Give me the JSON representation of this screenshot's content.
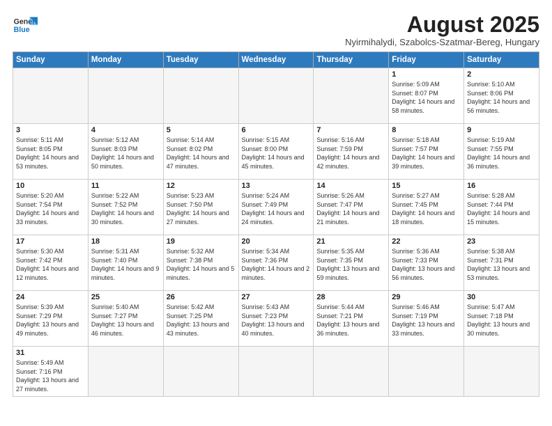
{
  "logo": {
    "line1": "General",
    "line2": "Blue"
  },
  "title": "August 2025",
  "location": "Nyirmihalydi, Szabolcs-Szatmar-Bereg, Hungary",
  "days_of_week": [
    "Sunday",
    "Monday",
    "Tuesday",
    "Wednesday",
    "Thursday",
    "Friday",
    "Saturday"
  ],
  "weeks": [
    [
      {
        "day": "",
        "info": ""
      },
      {
        "day": "",
        "info": ""
      },
      {
        "day": "",
        "info": ""
      },
      {
        "day": "",
        "info": ""
      },
      {
        "day": "",
        "info": ""
      },
      {
        "day": "1",
        "info": "Sunrise: 5:09 AM\nSunset: 8:07 PM\nDaylight: 14 hours and 58 minutes."
      },
      {
        "day": "2",
        "info": "Sunrise: 5:10 AM\nSunset: 8:06 PM\nDaylight: 14 hours and 56 minutes."
      }
    ],
    [
      {
        "day": "3",
        "info": "Sunrise: 5:11 AM\nSunset: 8:05 PM\nDaylight: 14 hours and 53 minutes."
      },
      {
        "day": "4",
        "info": "Sunrise: 5:12 AM\nSunset: 8:03 PM\nDaylight: 14 hours and 50 minutes."
      },
      {
        "day": "5",
        "info": "Sunrise: 5:14 AM\nSunset: 8:02 PM\nDaylight: 14 hours and 47 minutes."
      },
      {
        "day": "6",
        "info": "Sunrise: 5:15 AM\nSunset: 8:00 PM\nDaylight: 14 hours and 45 minutes."
      },
      {
        "day": "7",
        "info": "Sunrise: 5:16 AM\nSunset: 7:59 PM\nDaylight: 14 hours and 42 minutes."
      },
      {
        "day": "8",
        "info": "Sunrise: 5:18 AM\nSunset: 7:57 PM\nDaylight: 14 hours and 39 minutes."
      },
      {
        "day": "9",
        "info": "Sunrise: 5:19 AM\nSunset: 7:55 PM\nDaylight: 14 hours and 36 minutes."
      }
    ],
    [
      {
        "day": "10",
        "info": "Sunrise: 5:20 AM\nSunset: 7:54 PM\nDaylight: 14 hours and 33 minutes."
      },
      {
        "day": "11",
        "info": "Sunrise: 5:22 AM\nSunset: 7:52 PM\nDaylight: 14 hours and 30 minutes."
      },
      {
        "day": "12",
        "info": "Sunrise: 5:23 AM\nSunset: 7:50 PM\nDaylight: 14 hours and 27 minutes."
      },
      {
        "day": "13",
        "info": "Sunrise: 5:24 AM\nSunset: 7:49 PM\nDaylight: 14 hours and 24 minutes."
      },
      {
        "day": "14",
        "info": "Sunrise: 5:26 AM\nSunset: 7:47 PM\nDaylight: 14 hours and 21 minutes."
      },
      {
        "day": "15",
        "info": "Sunrise: 5:27 AM\nSunset: 7:45 PM\nDaylight: 14 hours and 18 minutes."
      },
      {
        "day": "16",
        "info": "Sunrise: 5:28 AM\nSunset: 7:44 PM\nDaylight: 14 hours and 15 minutes."
      }
    ],
    [
      {
        "day": "17",
        "info": "Sunrise: 5:30 AM\nSunset: 7:42 PM\nDaylight: 14 hours and 12 minutes."
      },
      {
        "day": "18",
        "info": "Sunrise: 5:31 AM\nSunset: 7:40 PM\nDaylight: 14 hours and 9 minutes."
      },
      {
        "day": "19",
        "info": "Sunrise: 5:32 AM\nSunset: 7:38 PM\nDaylight: 14 hours and 5 minutes."
      },
      {
        "day": "20",
        "info": "Sunrise: 5:34 AM\nSunset: 7:36 PM\nDaylight: 14 hours and 2 minutes."
      },
      {
        "day": "21",
        "info": "Sunrise: 5:35 AM\nSunset: 7:35 PM\nDaylight: 13 hours and 59 minutes."
      },
      {
        "day": "22",
        "info": "Sunrise: 5:36 AM\nSunset: 7:33 PM\nDaylight: 13 hours and 56 minutes."
      },
      {
        "day": "23",
        "info": "Sunrise: 5:38 AM\nSunset: 7:31 PM\nDaylight: 13 hours and 53 minutes."
      }
    ],
    [
      {
        "day": "24",
        "info": "Sunrise: 5:39 AM\nSunset: 7:29 PM\nDaylight: 13 hours and 49 minutes."
      },
      {
        "day": "25",
        "info": "Sunrise: 5:40 AM\nSunset: 7:27 PM\nDaylight: 13 hours and 46 minutes."
      },
      {
        "day": "26",
        "info": "Sunrise: 5:42 AM\nSunset: 7:25 PM\nDaylight: 13 hours and 43 minutes."
      },
      {
        "day": "27",
        "info": "Sunrise: 5:43 AM\nSunset: 7:23 PM\nDaylight: 13 hours and 40 minutes."
      },
      {
        "day": "28",
        "info": "Sunrise: 5:44 AM\nSunset: 7:21 PM\nDaylight: 13 hours and 36 minutes."
      },
      {
        "day": "29",
        "info": "Sunrise: 5:46 AM\nSunset: 7:19 PM\nDaylight: 13 hours and 33 minutes."
      },
      {
        "day": "30",
        "info": "Sunrise: 5:47 AM\nSunset: 7:18 PM\nDaylight: 13 hours and 30 minutes."
      }
    ],
    [
      {
        "day": "31",
        "info": "Sunrise: 5:49 AM\nSunset: 7:16 PM\nDaylight: 13 hours and 27 minutes."
      },
      {
        "day": "",
        "info": ""
      },
      {
        "day": "",
        "info": ""
      },
      {
        "day": "",
        "info": ""
      },
      {
        "day": "",
        "info": ""
      },
      {
        "day": "",
        "info": ""
      },
      {
        "day": "",
        "info": ""
      }
    ]
  ]
}
